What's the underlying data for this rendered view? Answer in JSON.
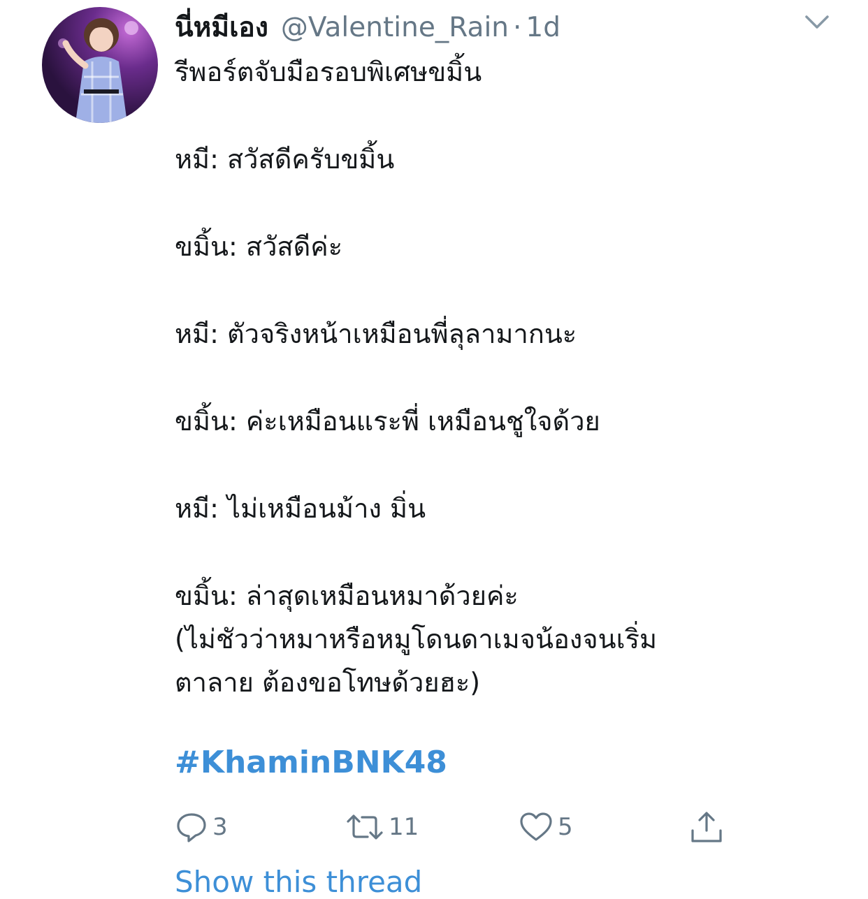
{
  "tweet": {
    "display_name": "นี่หมีเอง",
    "handle": "@Valentine_Rain",
    "separator": "·",
    "time": "1d",
    "lines": [
      "รีพอร์ตจับมือรอบพิเศษขมิ้น",
      "",
      "หมี: สวัสดีครับขมิ้น",
      "",
      "ขมิ้น: สวัสดีค่ะ",
      "",
      "หมี: ตัวจริงหน้าเหมือนพี่ลุลามากนะ",
      "",
      "ขมิ้น: ค่ะเหมือนแระพี่ เหมือนชูใจด้วย",
      "",
      "หมี: ไม่เหมือนม้าง มิ่น",
      "",
      "ขมิ้น: ล่าสุดเหมือนหมาด้วยค่ะ",
      "(ไม่ชัวว่าหมาหรือหมูโดนดาเมจน้องจนเริ่ม",
      "ตาลาย ต้องขอโทษด้วยฮะ)"
    ],
    "hashtag": "#KhaminBNK48"
  },
  "actions": {
    "reply_icon": "reply-icon",
    "reply_count": "3",
    "retweet_icon": "retweet-icon",
    "retweet_count": "11",
    "like_icon": "heart-icon",
    "like_count": "5",
    "share_icon": "share-icon"
  },
  "show_thread": "Show this thread",
  "colors": {
    "link": "#3d8fd7",
    "secondary_text": "#657786",
    "primary_text": "#14171a"
  }
}
